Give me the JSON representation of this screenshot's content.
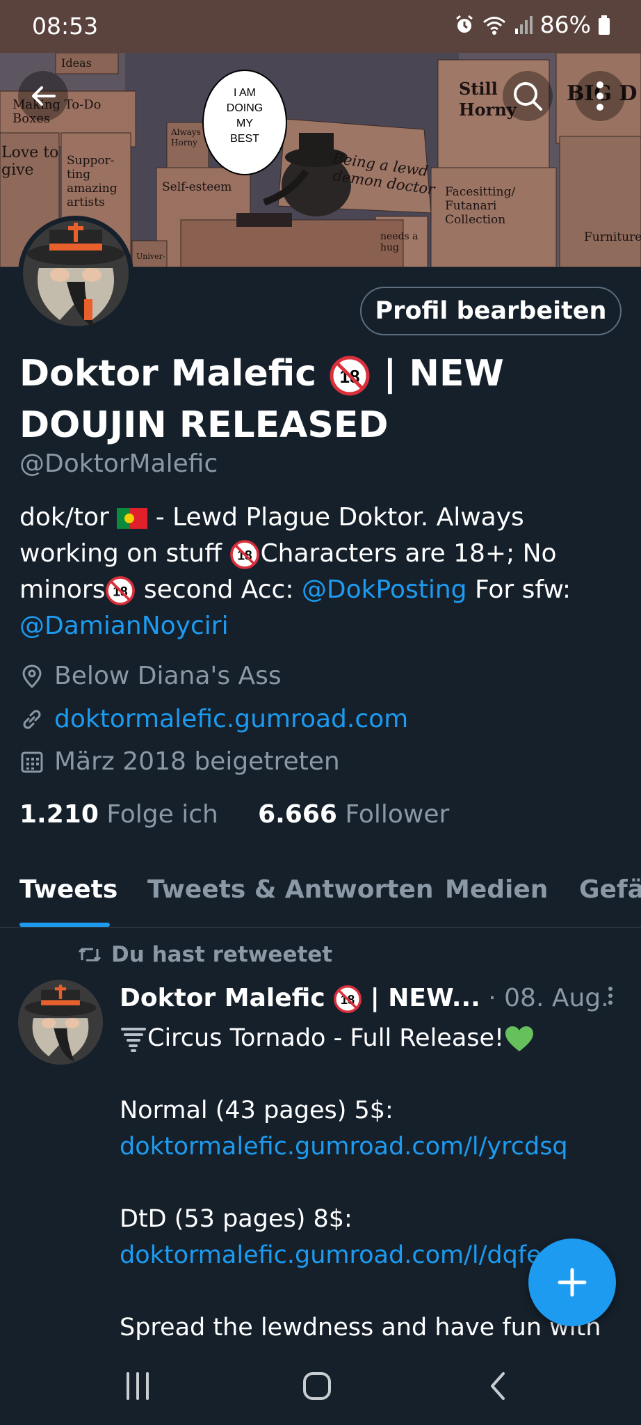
{
  "status_bar": {
    "time": "08:53",
    "battery": "86%",
    "icons": [
      "alarm-icon",
      "wifi-icon",
      "signal-icon",
      "battery-icon"
    ]
  },
  "banner": {
    "boxes": [
      "Ideas",
      "Making To-Do Boxes",
      "Love to give",
      "Suppor-ting amazing artists",
      "Always Horny",
      "Self-esteem",
      "Univer-sity",
      "Still Horny",
      "BIG D",
      "Being a lewd demon doctor",
      "Facesitting/ Futanari Collection",
      "needs a hug",
      "Furniture"
    ],
    "speech_bubble": "I AM DOING MY BEST"
  },
  "profile": {
    "edit_button": "Profil bearbeiten",
    "name_line1": "Doktor Malefic",
    "name_line1_suffix": "| NEW",
    "name_line2": "DOUJIN RELEASED",
    "handle": "@DoktorMalefic",
    "bio": {
      "part1": "dok/tor",
      "part2": "- Lewd Plague Doktor. Always working on stuff",
      "part3": "Characters are 18+; No minors",
      "part4": "second Acc:",
      "mention1": "@DokPosting",
      "part5": "For sfw:",
      "mention2": "@DamianNoyciri"
    },
    "location": "Below Diana's Ass",
    "website": "doktormalefic.gumroad.com",
    "joined": "März 2018 beigetreten",
    "following_count": "1.210",
    "following_label": "Folge ich",
    "followers_count": "6.666",
    "followers_label": "Follower"
  },
  "tabs": [
    "Tweets",
    "Tweets & Antworten",
    "Medien",
    "Gefä"
  ],
  "tweet": {
    "retweet_label": "Du hast retweetet",
    "author": "Doktor Malefic",
    "author_suffix": "| NEW...",
    "date": "· 08. Aug.",
    "line1": "Circus Tornado - Full Release!",
    "line2": "Normal (43 pages) 5$:",
    "link1": "doktormalefic.gumroad.com/l/yrcdsq",
    "line3": "DtD (53 pages) 8$:",
    "link2": "doktormalefic.gumroad.com/l/dqfe",
    "line4": "Spread the lewdness and have fun with"
  },
  "colors": {
    "background": "#15202b",
    "accent": "#1d9bf0",
    "secondary_text": "#8b98a5",
    "status_bar": "#5a423d"
  }
}
